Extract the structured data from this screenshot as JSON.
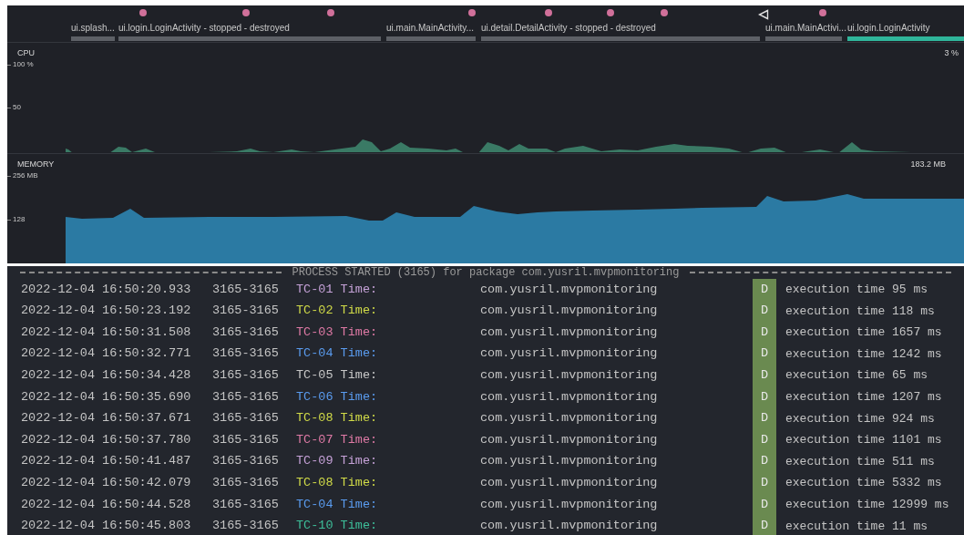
{
  "profiler": {
    "timeline": [
      {
        "label": "ui.splash...",
        "active": false
      },
      {
        "label": "ui.login.LoginActivity - stopped - destroyed",
        "active": false
      },
      {
        "label": "ui.main.MainActivity...",
        "active": false
      },
      {
        "label": "ui.detail.DetailActivity - stopped - destroyed",
        "active": false
      },
      {
        "label": "ui.main.MainActivi...",
        "active": false
      },
      {
        "label": "ui.login.LoginActivity",
        "active": true
      }
    ],
    "events": [
      {
        "kind": "touch"
      },
      {
        "kind": "touch"
      },
      {
        "kind": "touch"
      },
      {
        "kind": "touch"
      },
      {
        "kind": "touch"
      },
      {
        "kind": "touch"
      },
      {
        "kind": "touch"
      },
      {
        "kind": "back"
      },
      {
        "kind": "touch"
      }
    ],
    "cpu": {
      "title": "CPU",
      "reading": "3 %",
      "axis_labels": [
        "100 %",
        "50"
      ]
    },
    "memory": {
      "title": "MEMORY",
      "reading": "183.2 MB",
      "axis_labels": [
        "256 MB",
        "128"
      ]
    }
  },
  "logcat": {
    "header": "PROCESS STARTED (3165) for package com.yusril.mvpmonitoring",
    "rows": [
      {
        "time": "2022-12-04 16:50:20.933",
        "pid": "3165-3165",
        "tag": "TC-01 Time:",
        "color": "#c6a2d8",
        "package": "com.yusril.mvpmonitoring",
        "level": "D",
        "message": "execution time 95 ms"
      },
      {
        "time": "2022-12-04 16:50:23.192",
        "pid": "3165-3165",
        "tag": "TC-02 Time:",
        "color": "#d2dc48",
        "package": "com.yusril.mvpmonitoring",
        "level": "D",
        "message": "execution time 118 ms"
      },
      {
        "time": "2022-12-04 16:50:31.508",
        "pid": "3165-3165",
        "tag": "TC-03 Time:",
        "color": "#e07aa6",
        "package": "com.yusril.mvpmonitoring",
        "level": "D",
        "message": "execution time 1657 ms"
      },
      {
        "time": "2022-12-04 16:50:32.771",
        "pid": "3165-3165",
        "tag": "TC-04 Time:",
        "color": "#5a9cf0",
        "package": "com.yusril.mvpmonitoring",
        "level": "D",
        "message": "execution time 1242 ms"
      },
      {
        "time": "2022-12-04 16:50:34.428",
        "pid": "3165-3165",
        "tag": "TC-05 Time:",
        "color": "#c8c8c8",
        "package": "com.yusril.mvpmonitoring",
        "level": "D",
        "message": "execution time 65 ms"
      },
      {
        "time": "2022-12-04 16:50:35.690",
        "pid": "3165-3165",
        "tag": "TC-06 Time:",
        "color": "#5a9cf0",
        "package": "com.yusril.mvpmonitoring",
        "level": "D",
        "message": "execution time 1207 ms"
      },
      {
        "time": "2022-12-04 16:50:37.671",
        "pid": "3165-3165",
        "tag": "TC-08 Time:",
        "color": "#d2dc48",
        "package": "com.yusril.mvpmonitoring",
        "level": "D",
        "message": "execution time 924 ms"
      },
      {
        "time": "2022-12-04 16:50:37.780",
        "pid": "3165-3165",
        "tag": "TC-07 Time:",
        "color": "#e07aa6",
        "package": "com.yusril.mvpmonitoring",
        "level": "D",
        "message": "execution time 1101 ms"
      },
      {
        "time": "2022-12-04 16:50:41.487",
        "pid": "3165-3165",
        "tag": "TC-09 Time:",
        "color": "#c6a2d8",
        "package": "com.yusril.mvpmonitoring",
        "level": "D",
        "message": "execution time 511 ms"
      },
      {
        "time": "2022-12-04 16:50:42.079",
        "pid": "3165-3165",
        "tag": "TC-08 Time:",
        "color": "#d2dc48",
        "package": "com.yusril.mvpmonitoring",
        "level": "D",
        "message": "execution time 5332 ms"
      },
      {
        "time": "2022-12-04 16:50:44.528",
        "pid": "3165-3165",
        "tag": "TC-04 Time:",
        "color": "#5a9cf0",
        "package": "com.yusril.mvpmonitoring",
        "level": "D",
        "message": "execution time 12999 ms"
      },
      {
        "time": "2022-12-04 16:50:45.803",
        "pid": "3165-3165",
        "tag": "TC-10 Time:",
        "color": "#3dbf9a",
        "package": "com.yusril.mvpmonitoring",
        "level": "D",
        "message": "execution time 11 ms"
      }
    ]
  }
}
